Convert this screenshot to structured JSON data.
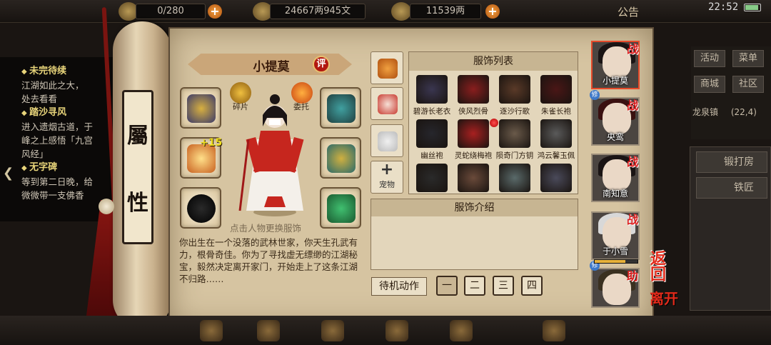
{
  "topbar": {
    "resource1": "0/280",
    "resource2": "24667两945文",
    "resource3": "11539两",
    "notice": "公告",
    "time": "22:52"
  },
  "quest": {
    "items": [
      {
        "title": "未完待续",
        "desc": "江湖如此之大，\n处去看看"
      },
      {
        "title": "踏沙寻风",
        "desc": "进入遗烟古道，于\n峰之上感悟「九宫\n风经」"
      },
      {
        "title": "无字碑",
        "desc": "等到第二日晚，给\n微微带一支佛香"
      }
    ]
  },
  "scroll": {
    "char1": "屬",
    "char2": "性"
  },
  "character": {
    "name": "小提莫",
    "review": "评",
    "fragment_label": "碎片",
    "entrust_label": "委托",
    "enhance": "+15",
    "change_hint": "点击人物更换服饰",
    "bio": "你出生在一个没落的武林世家，你天生孔武有力，根骨奇佳。你为了寻找虚无缥缈的江湖秘宝，毅然决定离开家门，开始走上了这条江湖不归路……"
  },
  "categories": {
    "pet": "宠物"
  },
  "clothing": {
    "header": "服饰列表",
    "items": [
      {
        "label": "碧游长老衣",
        "color": "#3a3650"
      },
      {
        "label": "侠风烈骨",
        "color": "#8a1e1e"
      },
      {
        "label": "逐沙行歌",
        "color": "#5a3a28"
      },
      {
        "label": "朱雀长袍",
        "color": "#4a1616"
      },
      {
        "label": "幽丝袍",
        "color": "#26262c"
      },
      {
        "label": "灵蛇绕梅袍",
        "color": "#a82020"
      },
      {
        "label": "陨奇门方钥",
        "color": "#6a5a4a"
      },
      {
        "label": "鸿云馨玉佩",
        "color": "#5a5a5a"
      },
      {
        "label": "",
        "color": "#2a2a2a"
      },
      {
        "label": "",
        "color": "#6a4a3a"
      },
      {
        "label": "",
        "color": "#5a6a6a"
      },
      {
        "label": "",
        "color": "#4a4a5a"
      }
    ],
    "intro_header": "服饰介绍"
  },
  "actions": {
    "idle": "待机动作",
    "nums": [
      "一",
      "二",
      "三",
      "四"
    ]
  },
  "roster": [
    {
      "name": "小提莫",
      "tag": "战",
      "selected": true
    },
    {
      "name": "央鸾",
      "tag": "战",
      "selected": false
    },
    {
      "name": "南知意",
      "tag": "战",
      "selected": false
    },
    {
      "name": "于小雪",
      "tag": "战",
      "selected": false
    },
    {
      "name": "",
      "tag": "助",
      "selected": false
    }
  ],
  "roster_badge": "修",
  "hp_level": 0.72,
  "return": "返回",
  "leave": "离开",
  "right_menu": {
    "buttons": [
      "活动",
      "菜单",
      "商城",
      "社区"
    ],
    "location": "龙泉镇",
    "coords": "(22,4)",
    "forge": "锻打房",
    "smith": "铁匠"
  },
  "colors": {
    "parchment": "#d6c4a1",
    "accent_red": "#d22222",
    "gold": "#f0e020"
  }
}
